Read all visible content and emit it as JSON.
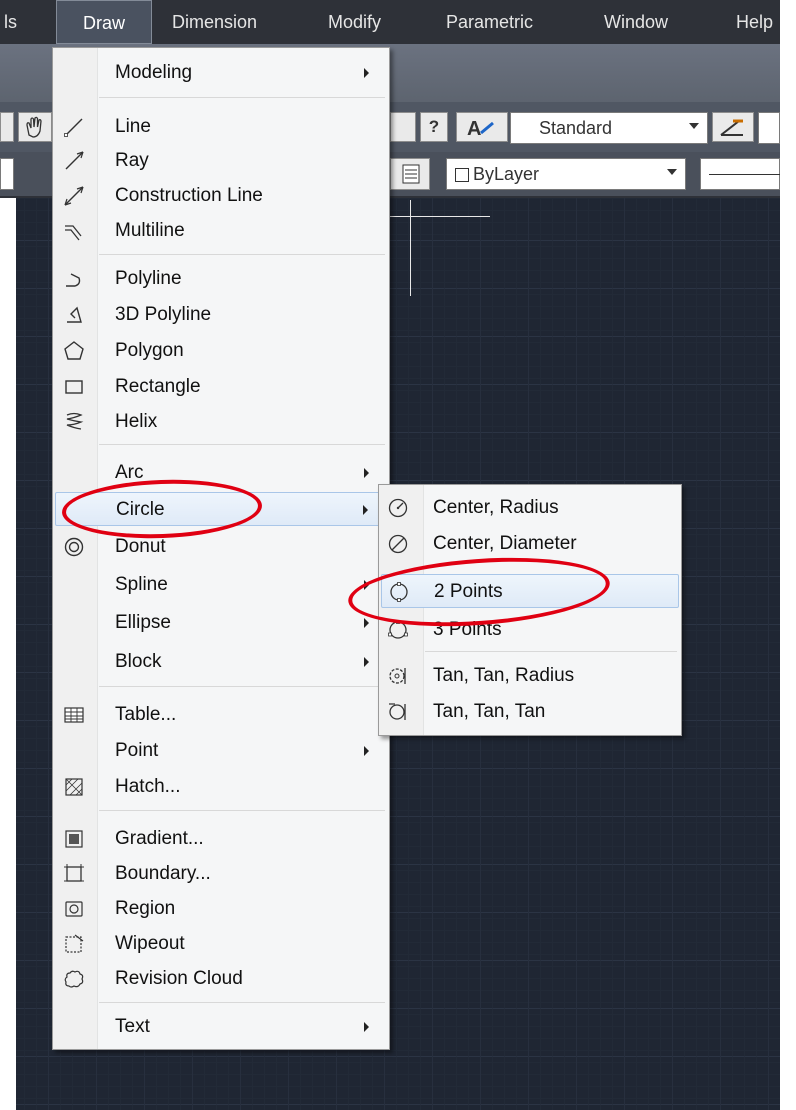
{
  "menubar": {
    "items": [
      {
        "label": "ls"
      },
      {
        "label": "Draw",
        "active": true
      },
      {
        "label": "Dimension"
      },
      {
        "label": "Modify"
      },
      {
        "label": "Parametric"
      },
      {
        "label": "Window"
      },
      {
        "label": "Help"
      }
    ]
  },
  "toolbar": {
    "text_style": "Standard",
    "layer": "ByLayer",
    "help_glyph": "?",
    "text_glyph": "A"
  },
  "draw_menu": {
    "items": [
      {
        "label": "Modeling",
        "submenu": true,
        "icon": ""
      },
      {
        "label": "Line",
        "icon": "line-icon"
      },
      {
        "label": "Ray",
        "icon": "ray-icon"
      },
      {
        "label": "Construction Line",
        "icon": "construction-line-icon"
      },
      {
        "label": "Multiline",
        "icon": "multiline-icon"
      },
      {
        "label": "Polyline",
        "icon": "polyline-icon"
      },
      {
        "label": "3D Polyline",
        "icon": "3d-polyline-icon"
      },
      {
        "label": "Polygon",
        "icon": "polygon-icon"
      },
      {
        "label": "Rectangle",
        "icon": "rectangle-icon"
      },
      {
        "label": "Helix",
        "icon": "helix-icon"
      },
      {
        "label": "Arc",
        "submenu": true,
        "icon": ""
      },
      {
        "label": "Circle",
        "submenu": true,
        "highlighted": true,
        "icon": ""
      },
      {
        "label": "Donut",
        "icon": "donut-icon"
      },
      {
        "label": "Spline",
        "submenu": true,
        "icon": ""
      },
      {
        "label": "Ellipse",
        "submenu": true,
        "icon": ""
      },
      {
        "label": "Block",
        "submenu": true,
        "icon": ""
      },
      {
        "label": "Table...",
        "icon": "table-icon"
      },
      {
        "label": "Point",
        "submenu": true,
        "icon": ""
      },
      {
        "label": "Hatch...",
        "icon": "hatch-icon"
      },
      {
        "label": "Gradient...",
        "icon": "gradient-icon"
      },
      {
        "label": "Boundary...",
        "icon": "boundary-icon"
      },
      {
        "label": "Region",
        "icon": "region-icon"
      },
      {
        "label": "Wipeout",
        "icon": "wipeout-icon"
      },
      {
        "label": "Revision Cloud",
        "icon": "revision-cloud-icon"
      },
      {
        "label": "Text",
        "submenu": true,
        "icon": ""
      }
    ]
  },
  "circle_submenu": {
    "items": [
      {
        "label": "Center, Radius",
        "icon": "center-radius-icon"
      },
      {
        "label": "Center, Diameter",
        "icon": "center-diameter-icon"
      },
      {
        "label": "2 Points",
        "icon": "two-points-circle-icon",
        "highlighted": true
      },
      {
        "label": "3 Points",
        "icon": "three-points-circle-icon"
      },
      {
        "label": "Tan, Tan, Radius",
        "icon": "tan-tan-radius-icon"
      },
      {
        "label": "Tan, Tan, Tan",
        "icon": "tan-tan-tan-icon"
      }
    ]
  },
  "colors": {
    "annotation": "#e00012",
    "canvas": "#1f2633",
    "highlight": "#dfeaf7"
  }
}
